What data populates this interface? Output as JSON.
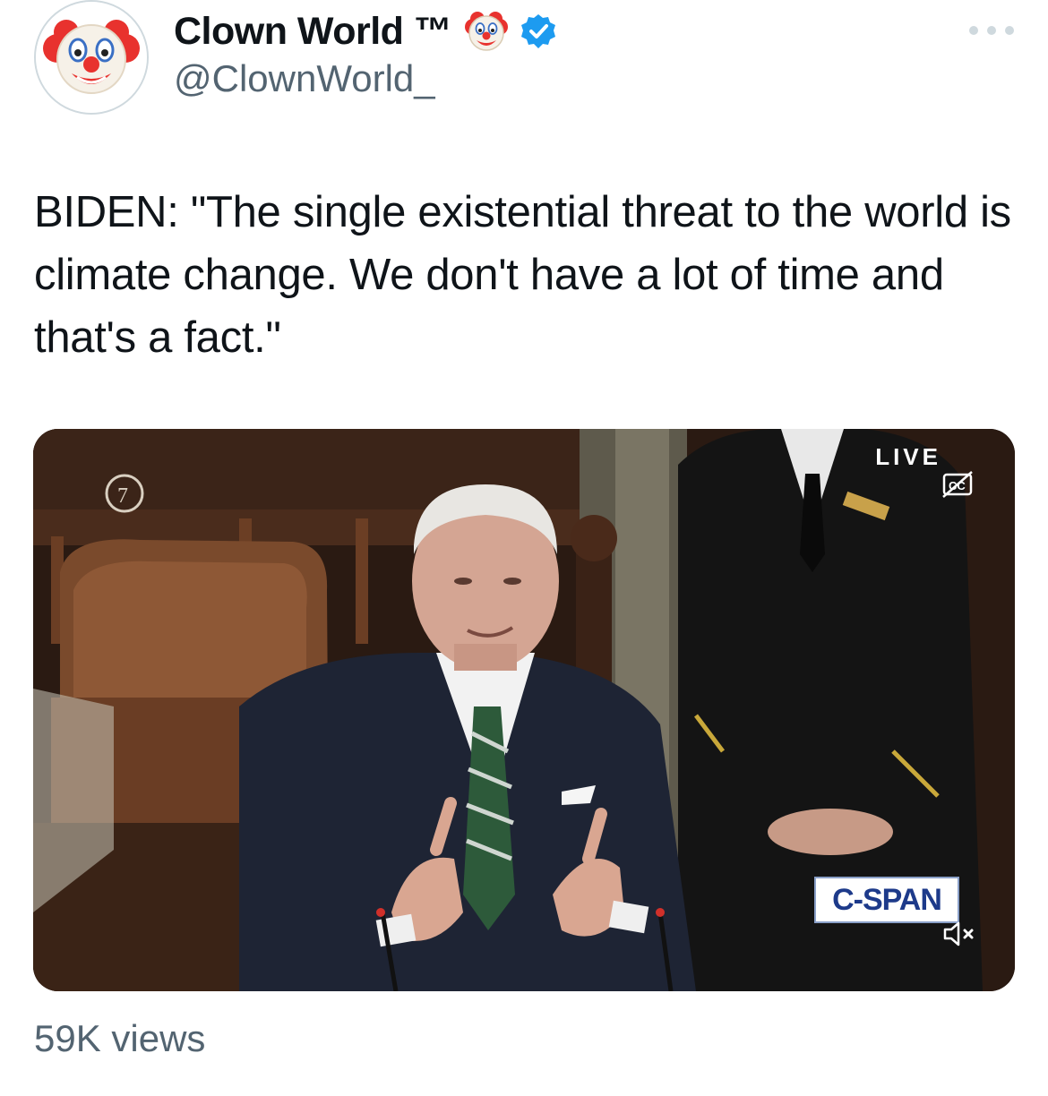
{
  "author": {
    "display_name": "Clown World ™",
    "handle": "@ClownWorld_",
    "avatar_icon": "clown-face-icon",
    "name_emoji_icon": "clown-face-icon",
    "verified_icon": "verified-badge-icon",
    "verified_color": "#1d9bf0"
  },
  "tweet": {
    "text": "BIDEN: \"The single existential threat to the world is climate change. We don't have a lot of time and that's a fact.\""
  },
  "media": {
    "live_label": "LIVE",
    "network_logo_text": "C-SPAN",
    "captions_icon": "closed-captions-off-icon",
    "mute_icon": "speaker-muted-icon"
  },
  "stats": {
    "views": "59K views"
  },
  "menu": {
    "more_icon": "more-options-icon"
  },
  "colors": {
    "text": "#0f1419",
    "secondary_text": "#536471",
    "accent": "#1d9bf0"
  }
}
